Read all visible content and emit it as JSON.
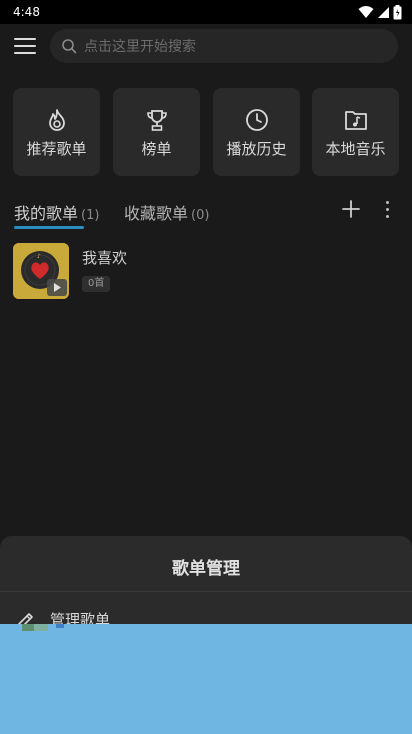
{
  "status_bar": {
    "time": "4:48"
  },
  "search": {
    "placeholder": "点击这里开始搜索"
  },
  "quick_links": [
    {
      "label": "推荐歌单",
      "icon": "fire-icon"
    },
    {
      "label": "榜单",
      "icon": "trophy-icon"
    },
    {
      "label": "播放历史",
      "icon": "clock-icon"
    },
    {
      "label": "本地音乐",
      "icon": "music-folder-icon"
    }
  ],
  "tabs": {
    "mine": {
      "label": "我的歌单",
      "count": "(1)"
    },
    "collected": {
      "label": "收藏歌单",
      "count": "(0)"
    }
  },
  "playlists": [
    {
      "title": "我喜欢",
      "count": "0首"
    }
  ],
  "sheet": {
    "title": "歌单管理",
    "items": [
      {
        "label": "管理歌单",
        "icon": "edit-icon"
      }
    ]
  },
  "colors": {
    "accent": "#2a8fbf",
    "background": "#1a1a1a",
    "overlay": "#6fb6e3"
  }
}
